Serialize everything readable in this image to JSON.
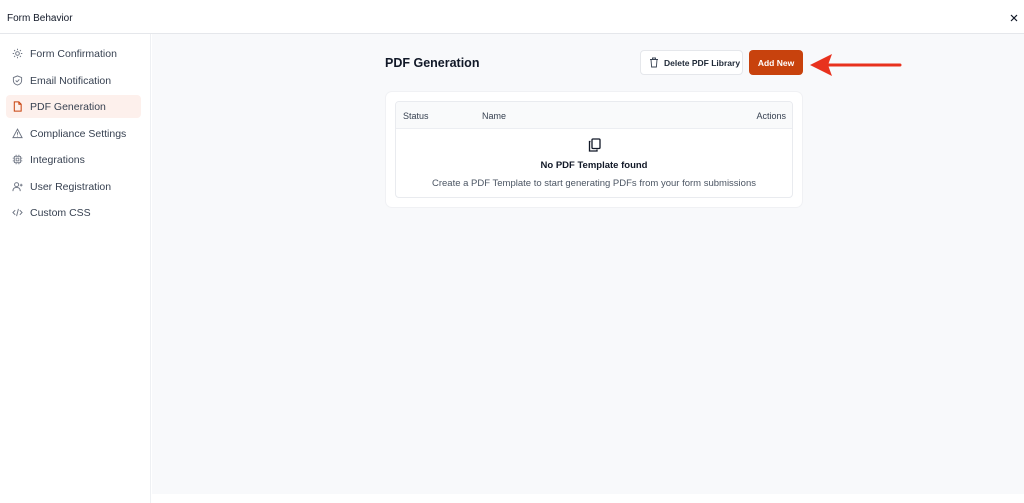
{
  "window": {
    "title": "Form Behavior",
    "close_icon": "close-icon"
  },
  "sidebar": {
    "items": [
      {
        "label": "Form Confirmation",
        "icon": "gear-icon",
        "active": false
      },
      {
        "label": "Email Notification",
        "icon": "shield-icon",
        "active": false
      },
      {
        "label": "PDF Generation",
        "icon": "document-icon",
        "active": true
      },
      {
        "label": "Compliance Settings",
        "icon": "warning-triangle-icon",
        "active": false
      },
      {
        "label": "Integrations",
        "icon": "chip-icon",
        "active": false
      },
      {
        "label": "User Registration",
        "icon": "user-plus-icon",
        "active": false
      },
      {
        "label": "Custom CSS",
        "icon": "code-icon",
        "active": false
      }
    ]
  },
  "main": {
    "title": "PDF Generation",
    "delete_button": {
      "label": "Delete PDF Library",
      "icon": "trash-icon"
    },
    "add_button": {
      "label": "Add New"
    },
    "table": {
      "columns": {
        "status": "Status",
        "name": "Name",
        "actions": "Actions"
      },
      "empty_title": "No PDF Template found",
      "empty_description": "Create a PDF Template to start generating PDFs from your form submissions",
      "empty_icon": "copy-icon"
    }
  },
  "colors": {
    "accent": "#c8420d",
    "active_bg": "#fdf0ec",
    "arrow": "#e8321e",
    "main_bg": "#f8f9fb"
  }
}
